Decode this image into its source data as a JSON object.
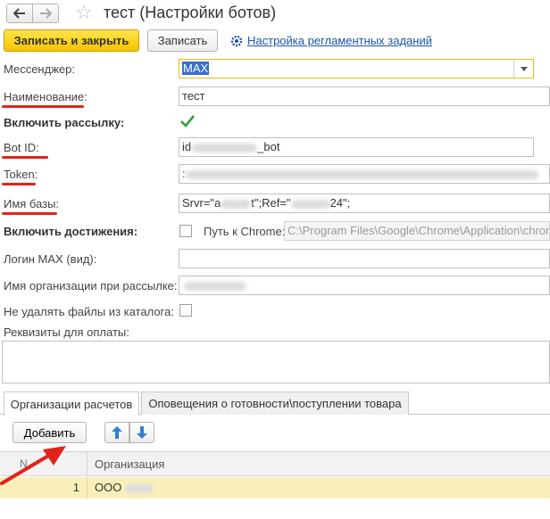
{
  "window": {
    "title": "тест (Настройки ботов)"
  },
  "toolbar": {
    "save_close_label": "Записать и закрыть",
    "save_label": "Записать",
    "schedule_link": "Настройка регламентных заданий"
  },
  "form": {
    "messenger": {
      "label": "Мессенджер:",
      "value": "MAX"
    },
    "name": {
      "label": "Наименование:",
      "value": "тест"
    },
    "enable_mailing": {
      "label": "Включить рассылку:",
      "checked": true
    },
    "bot_id": {
      "label": "Bot ID:",
      "value_start": "id",
      "value_end": "_bot"
    },
    "token": {
      "label": "Token:",
      "value_start": ":"
    },
    "db_name": {
      "label": "Имя базы:",
      "value_a": "Srvr=\"a",
      "value_b": "t\";Ref=\"",
      "value_c": "24\";"
    },
    "enable_achievements": {
      "label": "Включить достижения:",
      "checked": false
    },
    "chrome_path": {
      "label": "Путь к Chrome:",
      "placeholder": "C:\\Program Files\\Google\\Chrome\\Application\\chrome.exe"
    },
    "login_max": {
      "label": "Логин MAX (вид):",
      "value": ""
    },
    "org_name": {
      "label": "Имя организации при рассылке:"
    },
    "keep_files": {
      "label": "Не удалять файлы из каталога:",
      "checked": false
    },
    "payment_details": {
      "label": "Реквизиты для оплаты:",
      "value": ""
    }
  },
  "tabs": [
    {
      "label": "Организации расчетов",
      "active": true
    },
    {
      "label": "Оповещения о готовности\\поступлении товара",
      "active": false
    }
  ],
  "table": {
    "add_label": "Добавить",
    "columns": {
      "num": "N",
      "org": "Организация"
    },
    "rows": [
      {
        "num": "1",
        "org": "ООО"
      }
    ]
  },
  "colors": {
    "accent_yellow": "#f5c400",
    "link_blue": "#1b55a8",
    "annotation_red": "#e2231a",
    "row_highlight": "#fbefb9"
  }
}
